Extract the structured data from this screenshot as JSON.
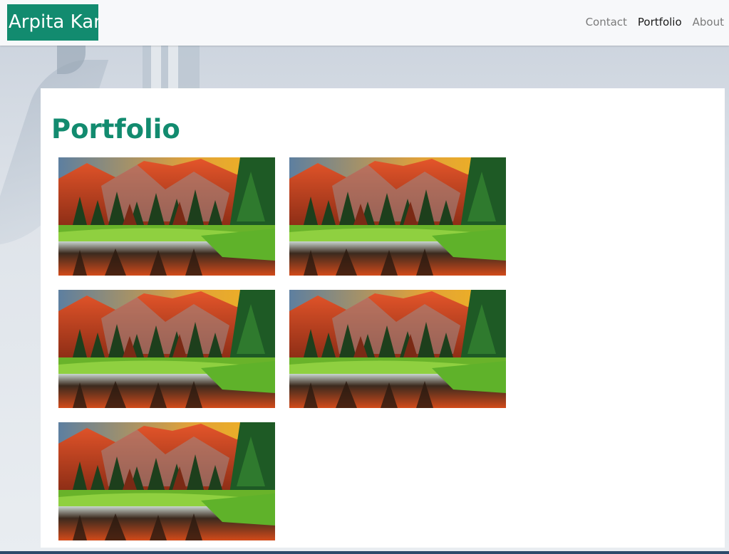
{
  "header": {
    "brand": "Arpita Kar",
    "nav": [
      {
        "label": "Contact",
        "active": false
      },
      {
        "label": "Portfolio",
        "active": true
      },
      {
        "label": "About",
        "active": false
      }
    ]
  },
  "main": {
    "title": "Portfolio",
    "images": [
      {
        "name": "landscape-image"
      },
      {
        "name": "landscape-image"
      },
      {
        "name": "landscape-image"
      },
      {
        "name": "landscape-image"
      },
      {
        "name": "landscape-image"
      }
    ]
  },
  "colors": {
    "brand": "#128b6f",
    "header_bg": "#f7f8fa",
    "nav_text": "#7a7a7a",
    "nav_active": "#1a1a1a"
  }
}
